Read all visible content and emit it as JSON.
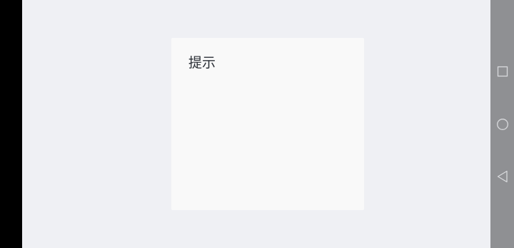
{
  "dialog": {
    "title": "提示"
  },
  "navigation_bar": {
    "icons": [
      "recents-square-icon",
      "home-circle-icon",
      "back-triangle-icon"
    ],
    "icon_color": "#d8d9dc",
    "background": "#8f9093"
  },
  "colors": {
    "app_background": "#eff0f4",
    "dialog_background": "#f9f9f9",
    "title_text": "#2b2f36"
  }
}
